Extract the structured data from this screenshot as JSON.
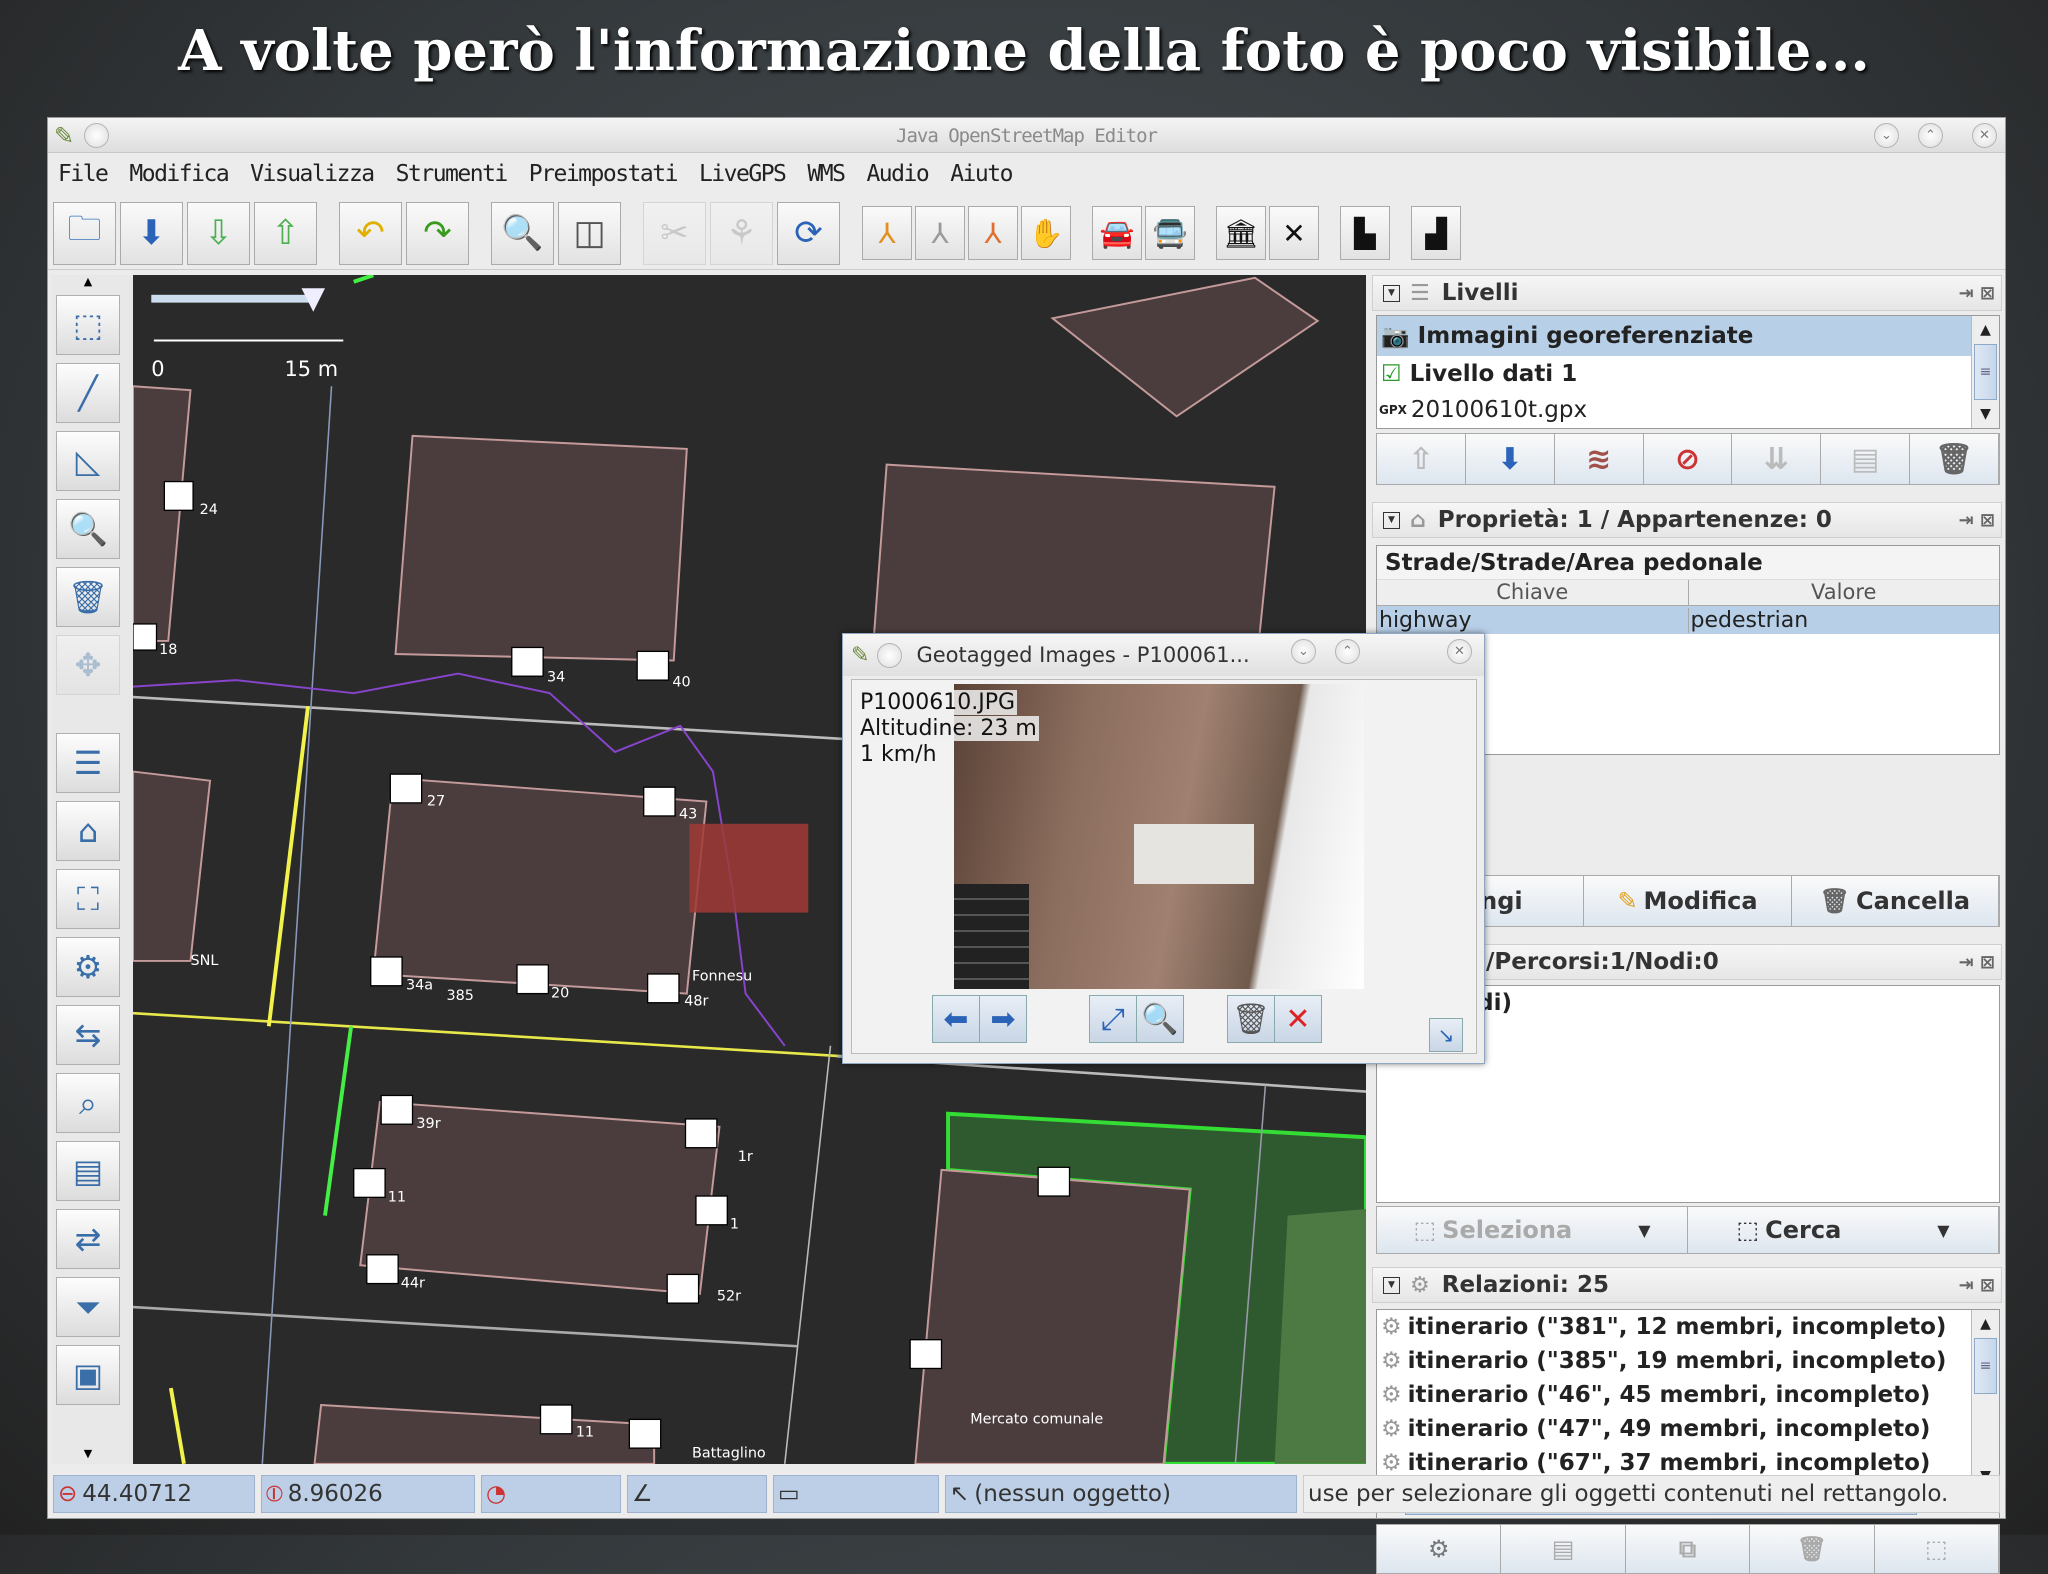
{
  "slide_title": "A volte però l'informazione della foto è poco visibile...",
  "window": {
    "title": "Java OpenStreetMap Editor"
  },
  "menu": [
    "File",
    "Modifica",
    "Visualizza",
    "Strumenti",
    "Preimpostati",
    "LiveGPS",
    "WMS",
    "Audio",
    "Aiuto"
  ],
  "toolbar": [
    {
      "icon": "open-file-icon",
      "g": "🗀",
      "c": "#3a78c0"
    },
    {
      "icon": "download-icon",
      "g": "⬇",
      "c": "#2a63b8"
    },
    {
      "icon": "upload-data-icon",
      "g": "⇩",
      "c": "#4caf50"
    },
    {
      "icon": "upload-icon",
      "g": "⇧",
      "c": "#4caf50"
    },
    {
      "sep": true
    },
    {
      "icon": "undo-icon",
      "g": "↶",
      "c": "#e0b000"
    },
    {
      "icon": "redo-icon",
      "g": "↷",
      "c": "#3a9a20"
    },
    {
      "sep": true
    },
    {
      "icon": "preferences-icon",
      "g": "🔍",
      "c": "#555"
    },
    {
      "icon": "toggle-panels-icon",
      "g": "◫",
      "c": "#555"
    },
    {
      "sep": true
    },
    {
      "icon": "split-way-icon",
      "g": "✂",
      "c": "#888",
      "dis": true
    },
    {
      "icon": "combine-way-icon",
      "g": "⚘",
      "c": "#888",
      "dis": true
    },
    {
      "icon": "reverse-icon",
      "g": "⟳",
      "c": "#2a63b8"
    },
    {
      "sep": true
    },
    {
      "icon": "draw-way-icon",
      "g": "⅄",
      "c": "#e09020",
      "s": true
    },
    {
      "icon": "draw-way-gray-icon",
      "g": "⅄",
      "c": "#999",
      "s": true
    },
    {
      "icon": "draw-node-icon",
      "g": "⅄",
      "c": "#e07030",
      "s": true
    },
    {
      "icon": "hand-icon",
      "g": "✋",
      "c": "#111",
      "s": true
    },
    {
      "sep": true
    },
    {
      "icon": "car-icon",
      "g": "🚘",
      "c": "#111",
      "s": true
    },
    {
      "icon": "bus-icon",
      "g": "🚍",
      "c": "#111",
      "s": true
    },
    {
      "sep": true
    },
    {
      "icon": "building-icon",
      "g": "🏛",
      "c": "#111",
      "s": true
    },
    {
      "icon": "cross-icon",
      "g": "✕",
      "c": "#111",
      "s": true
    },
    {
      "sep": true
    },
    {
      "icon": "wall-icon",
      "g": "▙",
      "c": "#111",
      "s": true
    },
    {
      "sep": true
    },
    {
      "icon": "factory-icon",
      "g": "▟",
      "c": "#111",
      "s": true
    }
  ],
  "left_tools": [
    {
      "icon": "select-icon",
      "g": "⬚"
    },
    {
      "icon": "draw-icon",
      "g": "╱"
    },
    {
      "icon": "triangle-icon",
      "g": "◺"
    },
    {
      "icon": "zoom-icon",
      "g": "🔍"
    },
    {
      "icon": "delete-icon",
      "g": "🗑"
    },
    {
      "icon": "move-icon",
      "g": "✥",
      "dis": true
    },
    {
      "icon": "layers-icon",
      "g": "☰"
    },
    {
      "icon": "tag-icon",
      "g": "⌂"
    },
    {
      "icon": "selection-icon",
      "g": "⛶"
    },
    {
      "icon": "relations-icon",
      "g": "⚙"
    },
    {
      "icon": "commands-icon",
      "g": "⇆"
    },
    {
      "icon": "history-icon",
      "g": "⌕"
    },
    {
      "icon": "conflict-icon",
      "g": "▤"
    },
    {
      "icon": "validator-icon",
      "g": "⇄"
    },
    {
      "icon": "filter-icon",
      "g": "⏷"
    },
    {
      "icon": "plugin-icon",
      "g": "▣"
    }
  ],
  "map": {
    "scale_start": "0",
    "scale_end": "15 m",
    "labels": [
      "24",
      "18",
      "34",
      "40",
      "27",
      "43",
      "SNL",
      "34a",
      "385",
      "20",
      "Fonnesu",
      "48r",
      "39r",
      "1r",
      "11",
      "1",
      "44r",
      "52r",
      "11",
      "Battaglino",
      "Mercato comunale"
    ]
  },
  "layers": {
    "title": "Livelli",
    "items": [
      {
        "label": "Immagini georeferenziate",
        "icon": "camera-icon",
        "selected": true
      },
      {
        "label": "Livello dati 1",
        "icon": "data-layer-icon"
      },
      {
        "label": "20100610t.gpx",
        "icon": "gpx-icon",
        "prefix": "GPX"
      }
    ],
    "buttons": [
      "move-up-icon",
      "move-down-icon",
      "activate-layer-icon",
      "toggle-visibility-icon",
      "merge-icon",
      "duplicate-icon",
      "delete-layer-icon"
    ]
  },
  "properties": {
    "title": "Proprietà: 1 / Appartenenze: 0",
    "preset": "Strade/Strade/Area pedonale",
    "col_key": "Chiave",
    "col_value": "Valore",
    "rows": [
      {
        "key": "highway",
        "value": "pedestrian"
      }
    ],
    "buttons": [
      {
        "label": "giungi",
        "icon": "add-icon"
      },
      {
        "label": "Modifica",
        "icon": "edit-icon"
      },
      {
        "label": "Cancella",
        "icon": "trash-icon"
      }
    ]
  },
  "selection": {
    "title": "l.: Rel.:0/Percorsi:1/Nodi:0",
    "items": [
      "la (2 nodi)"
    ],
    "btn_select": "Seleziona",
    "btn_search": "Cerca"
  },
  "relations": {
    "title": "Relazioni: 25",
    "items": [
      "itinerario (\"381\", 12 membri, incompleto)",
      "itinerario (\"385\", 19 membri, incompleto)",
      "itinerario (\"46\", 45 membri, incompleto)",
      "itinerario (\"47\", 49 membri, incompleto)",
      "itinerario (\"67\", 37 membri, incompleto)"
    ]
  },
  "status": {
    "lat": "44.40712",
    "lon": "8.96026",
    "name": "(nessun oggetto)",
    "help": "use per selezionare gli oggetti contenuti nel rettangolo."
  },
  "dialog": {
    "title": "Geotagged Images - P100061...",
    "filename": "P1000610.JPG",
    "altitude": "Altitudine: 23 m",
    "speed": "1 km/h"
  }
}
